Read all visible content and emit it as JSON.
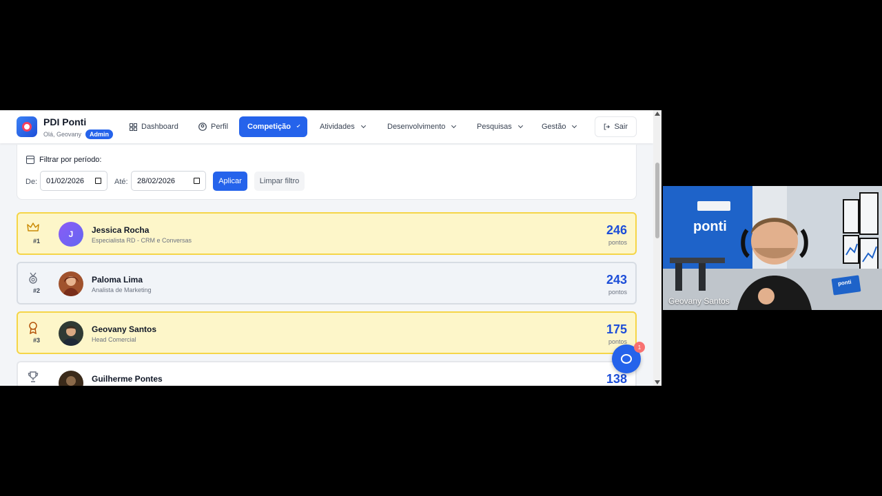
{
  "app": {
    "brand_title": "PDI Ponti",
    "greeting": "Olá, Geovany",
    "role_badge": "Admin"
  },
  "nav": {
    "dashboard": "Dashboard",
    "perfil": "Perfil",
    "competicao": "Competição",
    "atividades": "Atividades",
    "desenvolvimento": "Desenvolvimento",
    "pesquisas": "Pesquisas",
    "gestao": "Gestão",
    "sair": "Sair"
  },
  "filter": {
    "title": "Filtrar por período:",
    "from_label": "De:",
    "from_value": "01/02/2026",
    "to_label": "Até:",
    "to_value": "28/02/2026",
    "apply": "Aplicar",
    "clear": "Limpar filtro"
  },
  "ranking": [
    {
      "rank": "#1",
      "initial": "J",
      "name": "Jessica Rocha",
      "role": "Especialista RD - CRM e Conversas",
      "points": "246",
      "points_label": "pontos",
      "icon": "crown-icon"
    },
    {
      "rank": "#2",
      "name": "Paloma Lima",
      "role": "Analista de Marketing",
      "points": "243",
      "points_label": "pontos",
      "icon": "medal-icon"
    },
    {
      "rank": "#3",
      "name": "Geovany Santos",
      "role": "Head Comercial",
      "points": "175",
      "points_label": "pontos",
      "icon": "award-icon"
    },
    {
      "rank": "",
      "name": "Guilherme Pontes",
      "role": "",
      "points": "138",
      "points_label": "",
      "icon": "trophy-icon"
    }
  ],
  "chat": {
    "badge": "1"
  },
  "webcam": {
    "participant_name": "Geovany Santos",
    "wall_brand": "ponti",
    "laptop_brand": "ponti"
  },
  "colors": {
    "primary": "#2563eb",
    "gold_bg": "#fdf6c9",
    "gold_border": "#f5d547",
    "points": "#1d4ed8"
  }
}
